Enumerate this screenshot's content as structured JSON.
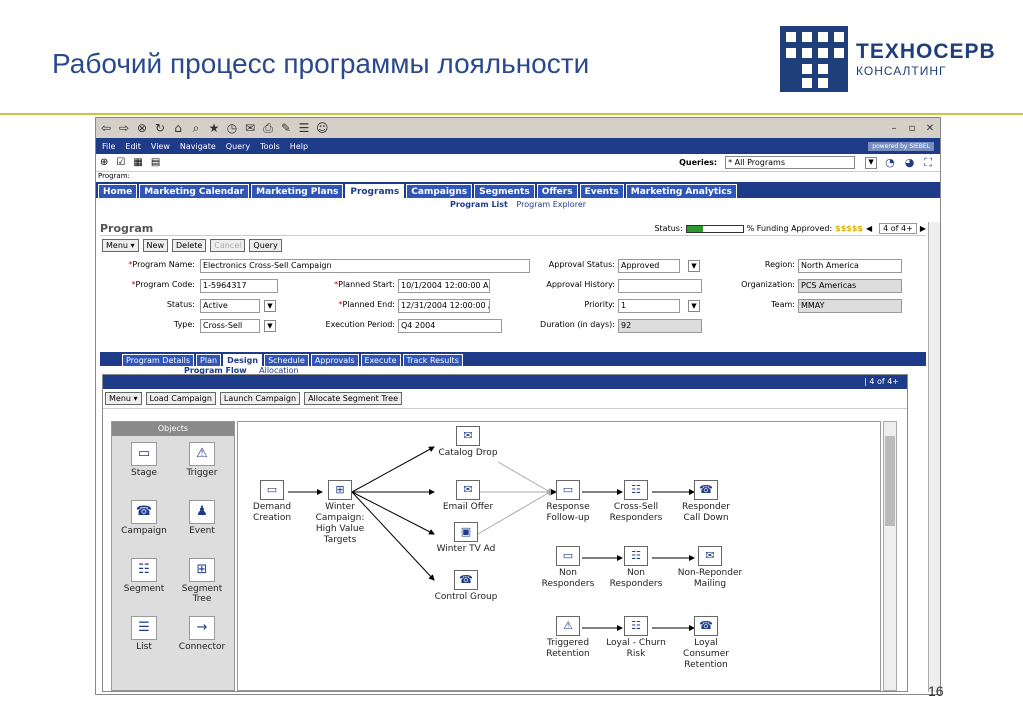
{
  "slide": {
    "title": "Рабочий процесс программы лояльности",
    "number": "16"
  },
  "logo": {
    "line1": "ТЕХНОСЕРВ",
    "line2": "КОНСАЛТИНГ"
  },
  "menu": {
    "items": [
      "File",
      "Edit",
      "View",
      "Navigate",
      "Query",
      "Tools",
      "Help"
    ],
    "powered": "powered by SIEBEL"
  },
  "queries": {
    "label": "Queries:",
    "value": "* All Programs"
  },
  "program_line": "Program:",
  "tabs": [
    "Home",
    "Marketing Calendar",
    "Marketing Plans",
    "Programs",
    "Campaigns",
    "Segments",
    "Offers",
    "Events",
    "Marketing Analytics"
  ],
  "subnav": {
    "active": "Program List",
    "other": "Program Explorer"
  },
  "applet": {
    "title": "Program",
    "status_label": "Status:",
    "funding_label": "% Funding Approved:",
    "funding_stars": "$$$$$",
    "status_progress": 0.3,
    "record_count": "4 of 4+",
    "buttons": {
      "menu": "Menu ▾",
      "new": "New",
      "delete": "Delete",
      "cancel": "Cancel",
      "query": "Query"
    }
  },
  "fields": {
    "program_name": {
      "label": "Program Name:",
      "value": "Electronics Cross-Sell Campaign"
    },
    "program_code": {
      "label": "Program Code:",
      "value": "1-5964317"
    },
    "status": {
      "label": "Status:",
      "value": "Active"
    },
    "type": {
      "label": "Type:",
      "value": "Cross-Sell"
    },
    "planned_start": {
      "label": "Planned Start:",
      "value": "10/1/2004 12:00:00 AI"
    },
    "planned_end": {
      "label": "Planned End:",
      "value": "12/31/2004 12:00:00 /"
    },
    "execution_period": {
      "label": "Execution Period:",
      "value": "Q4 2004"
    },
    "approval_status": {
      "label": "Approval Status:",
      "value": "Approved"
    },
    "approval_history": {
      "label": "Approval History:",
      "value": ""
    },
    "priority": {
      "label": "Priority:",
      "value": "1"
    },
    "duration": {
      "label": "Duration (in days):",
      "value": "92"
    },
    "region": {
      "label": "Region:",
      "value": "North America"
    },
    "organization": {
      "label": "Organization:",
      "value": "PCS Americas"
    },
    "team": {
      "label": "Team:",
      "value": "MMAY"
    }
  },
  "view_tabs": [
    "Program Details",
    "Plan",
    "Design",
    "Schedule",
    "Approvals",
    "Execute",
    "Track Results"
  ],
  "view_sub": {
    "active": "Program Flow",
    "other": "Allocation"
  },
  "flow": {
    "record_count": "| 4 of 4+",
    "buttons": {
      "menu": "Menu ▾",
      "load": "Load Campaign",
      "launch": "Launch Campaign",
      "allocate": "Allocate Segment Tree"
    },
    "palette_title": "Objects",
    "palette": [
      {
        "label": "Stage",
        "icon": "stage-icon"
      },
      {
        "label": "Trigger",
        "icon": "trigger-icon"
      },
      {
        "label": "Campaign",
        "icon": "campaign-icon"
      },
      {
        "label": "Event",
        "icon": "event-icon"
      },
      {
        "label": "Segment",
        "icon": "segment-icon"
      },
      {
        "label": "Segment Tree",
        "icon": "segment-tree-icon"
      },
      {
        "label": "List",
        "icon": "list-icon"
      },
      {
        "label": "Connector",
        "icon": "connector-icon"
      }
    ],
    "nodes": [
      {
        "label": "Demand Creation"
      },
      {
        "label": "Winter Campaign: High Value Targets"
      },
      {
        "label": "Catalog Drop"
      },
      {
        "label": "Email Offer"
      },
      {
        "label": "Winter TV Ad"
      },
      {
        "label": "Control Group"
      },
      {
        "label": "Response Follow-up"
      },
      {
        "label": "Cross-Sell Responders"
      },
      {
        "label": "Responder Call Down"
      },
      {
        "label": "Non Responders"
      },
      {
        "label": "Non Responders"
      },
      {
        "label": "Non-Reponder Mailing"
      },
      {
        "label": "Triggered Retention"
      },
      {
        "label": "Loyal - Churn Risk"
      },
      {
        "label": "Loyal Consumer Retention"
      }
    ]
  }
}
